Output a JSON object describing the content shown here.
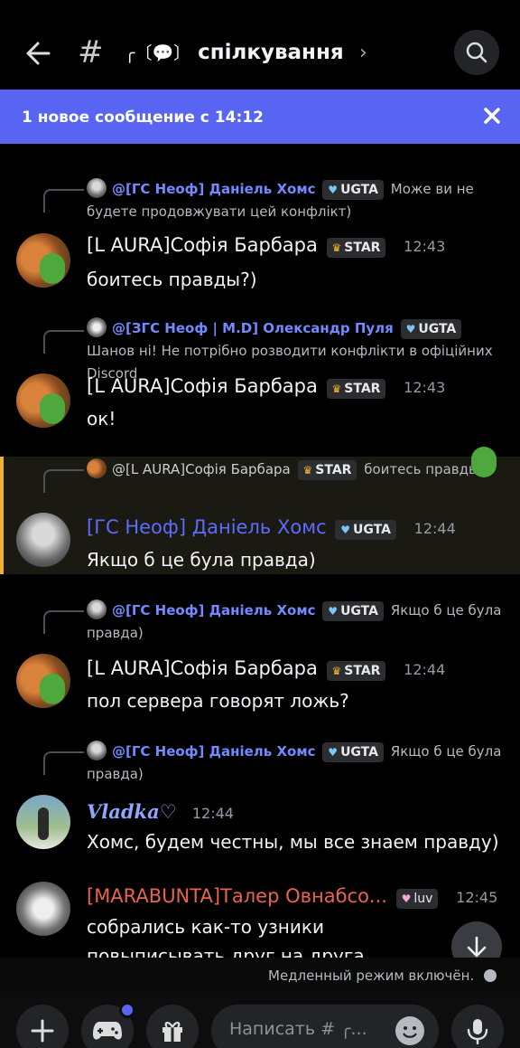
{
  "header": {
    "channel_prefix": "╭〔💬〕",
    "channel_name": "спілкування",
    "chevron": "›",
    "hash": "#"
  },
  "banner": {
    "text": "1 новое сообщение с 14:12"
  },
  "top_partial_text": "...",
  "messages": [
    {
      "reply": {
        "name": "@[ГС Неоф]  Даніель Хомс",
        "badge": "UGTA",
        "text": "Може ви не будете продовжувати цей конфлікт)"
      },
      "author": "[L AURA]Софія Барбара",
      "badge": "STAR",
      "time": "12:43",
      "text": "боитесь правды?)"
    },
    {
      "reply": {
        "name": "@[ЗГС Неоф | M.D] Олександр Пуля",
        "badge": "UGTA",
        "text": "Шанов ні! Не потрібно розводити конфлікти в офіційних Discord"
      },
      "author": "[L AURA]Софія Барбара",
      "badge": "STAR",
      "time": "12:43",
      "text": "ок!"
    },
    {
      "reply": {
        "name": "@[L AURA]Софія Барбара",
        "badge": "STAR",
        "text": "боитесь правды?)"
      },
      "author": "[ГС Неоф]  Даніель Хомс",
      "badge": "UGTA",
      "time": "12:44",
      "text": "Якщо б це була правда)"
    },
    {
      "reply": {
        "name": "@[ГС Неоф]  Даніель Хомс",
        "badge": "UGTA",
        "text": "Якщо б це була правда)"
      },
      "author": "[L AURA]Софія Барбара",
      "badge": "STAR",
      "time": "12:44",
      "text": "пол сервера говорят ложь?"
    },
    {
      "reply": {
        "name": "@[ГС Неоф]  Даніель Хомс",
        "badge": "UGTA",
        "text": "Якщо б це була правда)"
      },
      "author": "Vladka♡",
      "time": "12:44",
      "text": "Хомс, будем честны, мы все знаем правду)"
    },
    {
      "author": "[MARABUNTA]Талер Овнабсо...",
      "badge": "luv",
      "time": "12:45",
      "text": "собрались как-то узники повыписывать друг на друга хахахаха без негатива)))"
    }
  ],
  "slow_mode": "Медленный режим включён.",
  "composer": {
    "placeholder": "Написать # ╭..."
  },
  "colors": {
    "accent": "#5865f2",
    "highlight": "#f0b132",
    "mention": "#5b6cff",
    "red_name": "#e9644d"
  }
}
